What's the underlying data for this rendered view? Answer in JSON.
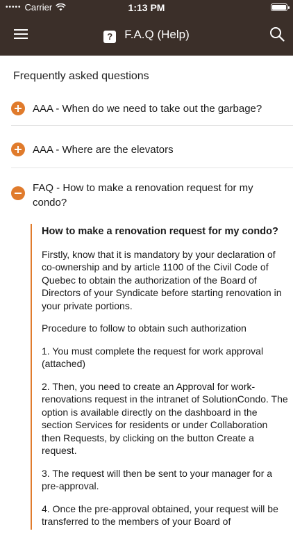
{
  "status": {
    "carrier": "Carrier",
    "time": "1:13 PM"
  },
  "nav": {
    "title": "F.A.Q (Help)",
    "help_glyph": "?"
  },
  "section_title": "Frequently asked questions",
  "faq": [
    {
      "label": "AAA - When do we need to take out the garbage?",
      "state": "collapsed"
    },
    {
      "label": "AAA - Where are the elevators",
      "state": "collapsed"
    },
    {
      "label": "FAQ - How to make a renovation request for my condo?",
      "state": "expanded"
    }
  ],
  "answer": {
    "heading": "How to make a renovation request for my condo?",
    "paragraphs": [
      "Firstly, know that it is mandatory by your declaration of co-ownership and by article 1100 of the Civil Code of Quebec to obtain the authorization of the Board of Directors of your Syndicate before starting renovation in your private portions.",
      "Procedure to follow to obtain such authorization",
      "1. You must complete the request for work approval (attached)",
      "2. Then, you need to create an Approval for work-renovations request in the intranet of SolutionCondo. The option is available directly on the dashboard in the section Services for residents or under Collaboration then Requests, by clicking on the button Create a request.",
      "3. The request will then be sent to your manager for a pre-approval.",
      "4. Once the pre-approval obtained, your request will be transferred to the members of your Board of"
    ]
  },
  "colors": {
    "header_bg": "#3b2f29",
    "accent": "#e07b2c"
  },
  "icons": [
    "wifi-icon",
    "battery-icon",
    "menu-icon",
    "help-icon",
    "search-icon",
    "expand-icon",
    "collapse-icon"
  ]
}
